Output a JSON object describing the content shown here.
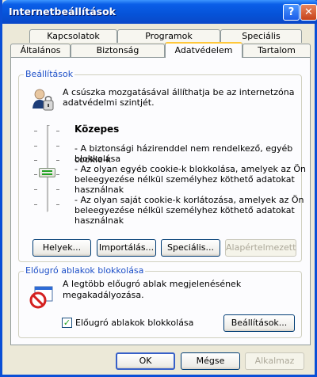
{
  "window": {
    "title": "Internetbeállítások",
    "help_icon": "?",
    "close_icon": "✕"
  },
  "tabs": {
    "row1": [
      "Kapcsolatok",
      "Programok",
      "Speciális"
    ],
    "row2": [
      "Általános",
      "Biztonság",
      "Adatvédelem",
      "Tartalom"
    ],
    "active": "Adatvédelem"
  },
  "settings": {
    "label": "Beállítások",
    "intro_line1": "A csúszka mozgatásával állíthatja be az internetzóna",
    "intro_line2": "adatvédelmi szintjét.",
    "level": "Közepes",
    "slider_position": "Közepes",
    "desc": [
      "- A biztonsági házirenddel nem rendelkező, egyéb cookie-k",
      "blokkolása",
      "- Az olyan egyéb cookie-k blokkolása, amelyek az Ön",
      "beleegyezése nélkül személyhez köthető adatokat",
      "használnak",
      "- Az olyan saját cookie-k korlátozása, amelyek az Ön",
      "beleegyezése nélkül személyhez köthető adatokat",
      "használnak"
    ],
    "buttons": {
      "sites": "Helyek...",
      "import": "Importálás...",
      "advanced": "Speciális...",
      "default": "Alapértelmezett"
    }
  },
  "popup": {
    "label": "Előugró ablakok blokkolása",
    "desc": "A legtöbb előugró ablak megjelenésének megakadályozása.",
    "checkbox_label": "Előugró ablakok blokkolása",
    "checked": true,
    "settings_button": "Beállítások..."
  },
  "footer": {
    "ok": "OK",
    "cancel": "Mégse",
    "apply": "Alkalmaz"
  }
}
